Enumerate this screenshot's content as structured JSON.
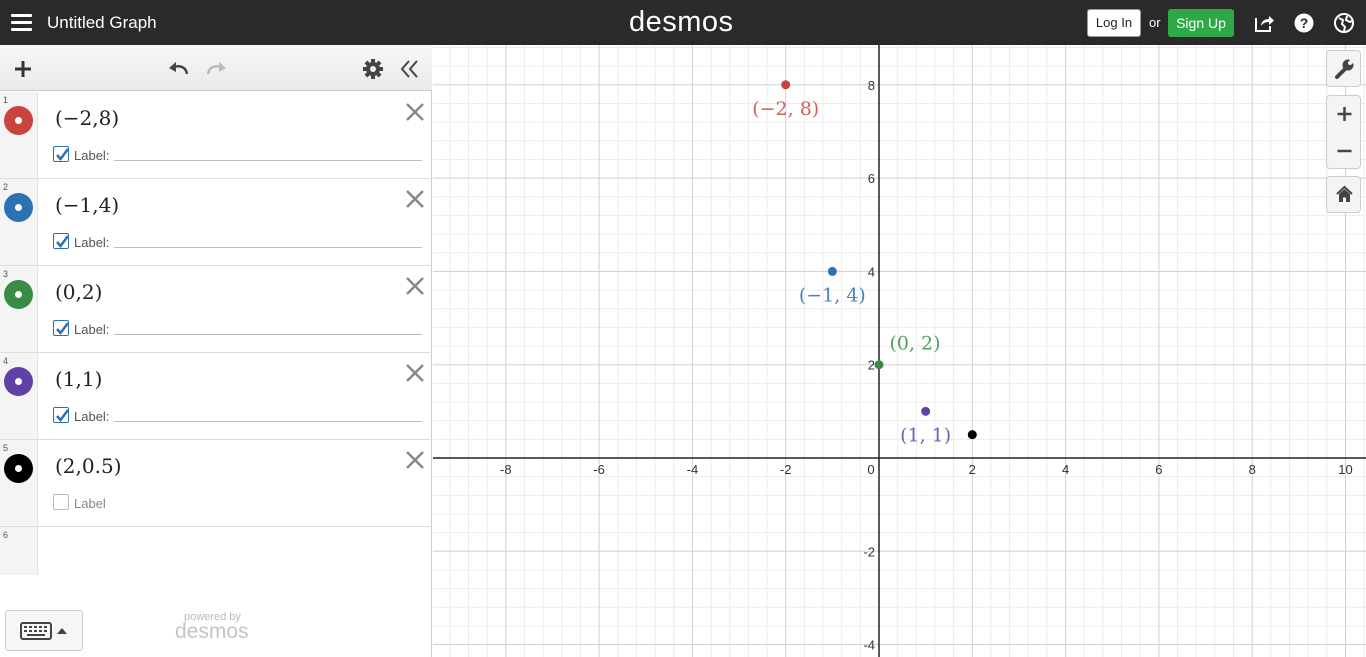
{
  "header": {
    "title": "Untitled Graph",
    "brand": "desmos",
    "login_label": "Log In",
    "or_text": "or",
    "signup_label": "Sign Up",
    "signup_color": "#2fa847",
    "icons": [
      "menu-icon",
      "share-icon",
      "help-icon",
      "globe-icon"
    ]
  },
  "expressions": [
    {
      "num": "1",
      "latex": "(−2,8)",
      "color": "#c74440",
      "label_checked": true,
      "label_text": "Label:"
    },
    {
      "num": "2",
      "latex": "(−1,4)",
      "color": "#2d70b3",
      "label_checked": true,
      "label_text": "Label:"
    },
    {
      "num": "3",
      "latex": "(0,2)",
      "color": "#388c46",
      "label_checked": true,
      "label_text": "Label:"
    },
    {
      "num": "4",
      "latex": "(1,1)",
      "color": "#6042a6",
      "label_checked": true,
      "label_text": "Label:"
    },
    {
      "num": "5",
      "latex": "(2,0.5)",
      "color": "#000000",
      "label_checked": false,
      "label_text": "Label"
    }
  ],
  "empty_expression_num": "6",
  "footer": {
    "powered_by": "powered by",
    "brand": "desmos"
  },
  "graph": {
    "x_ticks": [
      "-8",
      "-6",
      "-4",
      "-2",
      "0",
      "2",
      "4",
      "6",
      "8",
      "10"
    ],
    "y_ticks": [
      "8",
      "6",
      "4",
      "2",
      "-2",
      "-4"
    ],
    "points": [
      {
        "x": -2,
        "y": 8,
        "color": "#c74440",
        "label": "(−2, 8)",
        "show_label": true
      },
      {
        "x": -1,
        "y": 4,
        "color": "#2d70b3",
        "label": "(−1, 4)",
        "show_label": true
      },
      {
        "x": 0,
        "y": 2,
        "color": "#388c46",
        "label": "(0, 2)",
        "show_label": true
      },
      {
        "x": 1,
        "y": 1,
        "color": "#6042a6",
        "label": "(1, 1)",
        "show_label": true
      },
      {
        "x": 2,
        "y": 0.5,
        "color": "#000000",
        "label": "",
        "show_label": false
      }
    ]
  }
}
